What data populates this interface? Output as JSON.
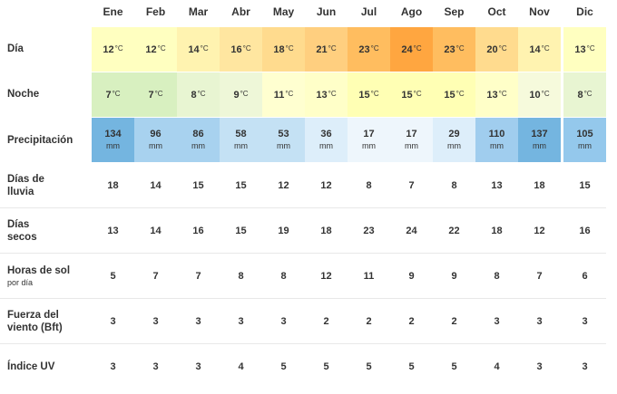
{
  "months": [
    "Ene",
    "Feb",
    "Mar",
    "Abr",
    "May",
    "Jun",
    "Jul",
    "Ago",
    "Sep",
    "Oct",
    "Nov",
    "Dic"
  ],
  "labels": {
    "dia": "Día",
    "noche": "Noche",
    "precipitacion": "Precipitación",
    "dias_lluvia_1": "Días de",
    "dias_lluvia_2": "lluvia",
    "dias_secos_1": "Días",
    "dias_secos_2": "secos",
    "horas_sol": "Horas de sol",
    "horas_sol_sub": "por día",
    "viento_1": "Fuerza del",
    "viento_2": "viento (Bft)",
    "uv": "Índice UV"
  },
  "units": {
    "temp": "°C",
    "precip": "mm"
  },
  "rows": {
    "dia": [
      "12",
      "12",
      "14",
      "16",
      "18",
      "21",
      "23",
      "24",
      "23",
      "20",
      "14",
      "13"
    ],
    "noche": [
      "7",
      "7",
      "8",
      "9",
      "11",
      "13",
      "15",
      "15",
      "15",
      "13",
      "10",
      "8"
    ],
    "precipitacion": [
      "134",
      "96",
      "86",
      "58",
      "53",
      "36",
      "17",
      "17",
      "29",
      "110",
      "137",
      "105"
    ],
    "dias_lluvia": [
      "18",
      "14",
      "15",
      "15",
      "12",
      "12",
      "8",
      "7",
      "8",
      "13",
      "18",
      "15"
    ],
    "dias_secos": [
      "13",
      "14",
      "16",
      "15",
      "19",
      "18",
      "23",
      "24",
      "22",
      "18",
      "12",
      "16"
    ],
    "horas_sol": [
      "5",
      "7",
      "7",
      "8",
      "8",
      "12",
      "11",
      "9",
      "9",
      "8",
      "7",
      "6"
    ],
    "viento": [
      "3",
      "3",
      "3",
      "3",
      "3",
      "2",
      "2",
      "2",
      "2",
      "3",
      "3",
      "3"
    ],
    "uv": [
      "3",
      "3",
      "3",
      "4",
      "5",
      "5",
      "5",
      "5",
      "5",
      "4",
      "3",
      "3"
    ]
  },
  "colors": {
    "dia": [
      "#ffffc0",
      "#ffffc0",
      "#fff3b0",
      "#ffe6a0",
      "#ffdb8e",
      "#ffcf7f",
      "#ffbd5f",
      "#ffa640",
      "#ffbd5f",
      "#ffdb8e",
      "#fff3b0",
      "#ffffc0"
    ],
    "noche": [
      "#d8f0c0",
      "#d8f0c0",
      "#e8f5d2",
      "#eef7d8",
      "#ffffd0",
      "#ffffc8",
      "#ffffb4",
      "#ffffb4",
      "#ffffb4",
      "#ffffc8",
      "#f6fadc",
      "#e8f5d2"
    ],
    "precipitacion": [
      "#74b5e0",
      "#a8d2ef",
      "#a8d2ef",
      "#c4e1f4",
      "#c4e1f4",
      "#ddeefa",
      "#eef6fc",
      "#eef6fc",
      "#ddeefa",
      "#a0cdee",
      "#74b5e0",
      "#94c8ec"
    ]
  }
}
